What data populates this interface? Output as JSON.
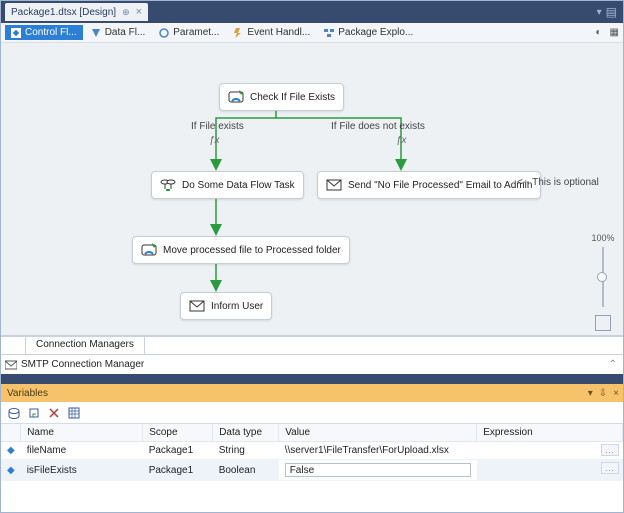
{
  "docTab": {
    "label": "Package1.dtsx [Design]"
  },
  "designerTabs": {
    "control": "Control Fl...",
    "data": "Data Fl...",
    "params": "Paramet...",
    "event": "Event Handl...",
    "pkg": "Package Explo..."
  },
  "flow": {
    "checkFile": "Check If File Exists",
    "branchYes": "If File exists",
    "branchNo": "If File does not exists",
    "fx": "ƒx",
    "dataFlow": "Do Some Data Flow Task",
    "sendEmail": "Send \"No File Processed\" Email to Admin",
    "optionalNote": "<-- This is optional",
    "moveFile": "Move processed file to Processed folder",
    "informUser": "Inform User"
  },
  "zoom": {
    "label": "100%"
  },
  "connMgr": {
    "tab": "Connection Managers",
    "item": "SMTP Connection Manager"
  },
  "variables": {
    "title": "Variables",
    "columns": {
      "name": "Name",
      "scope": "Scope",
      "datatype": "Data type",
      "value": "Value",
      "expression": "Expression"
    },
    "rows": [
      {
        "name": "fileName",
        "scope": "Package1",
        "datatype": "String",
        "value": "\\\\server1\\FileTransfer\\ForUpload.xlsx",
        "expression": ""
      },
      {
        "name": "isFileExists",
        "scope": "Package1",
        "datatype": "Boolean",
        "value": "False",
        "expression": ""
      }
    ]
  }
}
